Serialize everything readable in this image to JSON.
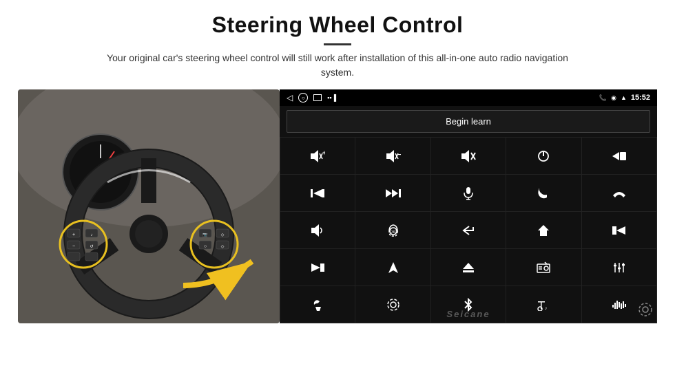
{
  "header": {
    "title": "Steering Wheel Control",
    "subtitle": "Your original car's steering wheel control will still work after installation of this all-in-one auto radio navigation system."
  },
  "status_bar": {
    "time": "15:52",
    "back_icon": "◁",
    "home_icon": "○",
    "recents_icon": "□",
    "media_icon": "▪▪▐",
    "phone_icon": "📞",
    "location_icon": "◉",
    "wifi_icon": "▲"
  },
  "begin_learn_button": "Begin learn",
  "controls": [
    {
      "icon": "🔊+",
      "label": "volume-up",
      "symbol": "🔊"
    },
    {
      "icon": "🔊-",
      "label": "volume-down",
      "symbol": "🔈"
    },
    {
      "icon": "🔇",
      "label": "mute",
      "symbol": "🔇"
    },
    {
      "icon": "⏻",
      "label": "power",
      "symbol": "⏻"
    },
    {
      "icon": "⏮",
      "label": "prev-track",
      "symbol": "⏮"
    },
    {
      "icon": "⏭",
      "label": "next",
      "symbol": "⏭"
    },
    {
      "icon": "⏩",
      "label": "fast-forward",
      "symbol": "⏩"
    },
    {
      "icon": "🎤",
      "label": "microphone",
      "symbol": "🎤"
    },
    {
      "icon": "📞",
      "label": "phone",
      "symbol": "📞"
    },
    {
      "icon": "📞",
      "label": "hang-up",
      "symbol": "📴"
    },
    {
      "icon": "📢",
      "label": "horn",
      "symbol": "📢"
    },
    {
      "icon": "🔄",
      "label": "360",
      "symbol": "360"
    },
    {
      "icon": "↩",
      "label": "back",
      "symbol": "↩"
    },
    {
      "icon": "⌂",
      "label": "home",
      "symbol": "⌂"
    },
    {
      "icon": "⏮⏮",
      "label": "skip-back",
      "symbol": "⏮"
    },
    {
      "icon": "⏭⏭",
      "label": "skip-next",
      "symbol": "⏭"
    },
    {
      "icon": "▶",
      "label": "navigate",
      "symbol": "▶"
    },
    {
      "icon": "⏏",
      "label": "eject",
      "symbol": "⏏"
    },
    {
      "icon": "📻",
      "label": "radio",
      "symbol": "📻"
    },
    {
      "icon": "⚙",
      "label": "settings-eq",
      "symbol": "⚙"
    },
    {
      "icon": "🎙",
      "label": "mic2",
      "symbol": "🎙"
    },
    {
      "icon": "⏺",
      "label": "record",
      "symbol": "⏺"
    },
    {
      "icon": "✱",
      "label": "bluetooth",
      "symbol": "✱"
    },
    {
      "icon": "🎵",
      "label": "music",
      "symbol": "🎵"
    },
    {
      "icon": "📊",
      "label": "equalizer",
      "symbol": "📊"
    }
  ],
  "watermark": "Seicane",
  "android_nav": {
    "back": "◁",
    "home": "○",
    "recents": "□"
  }
}
